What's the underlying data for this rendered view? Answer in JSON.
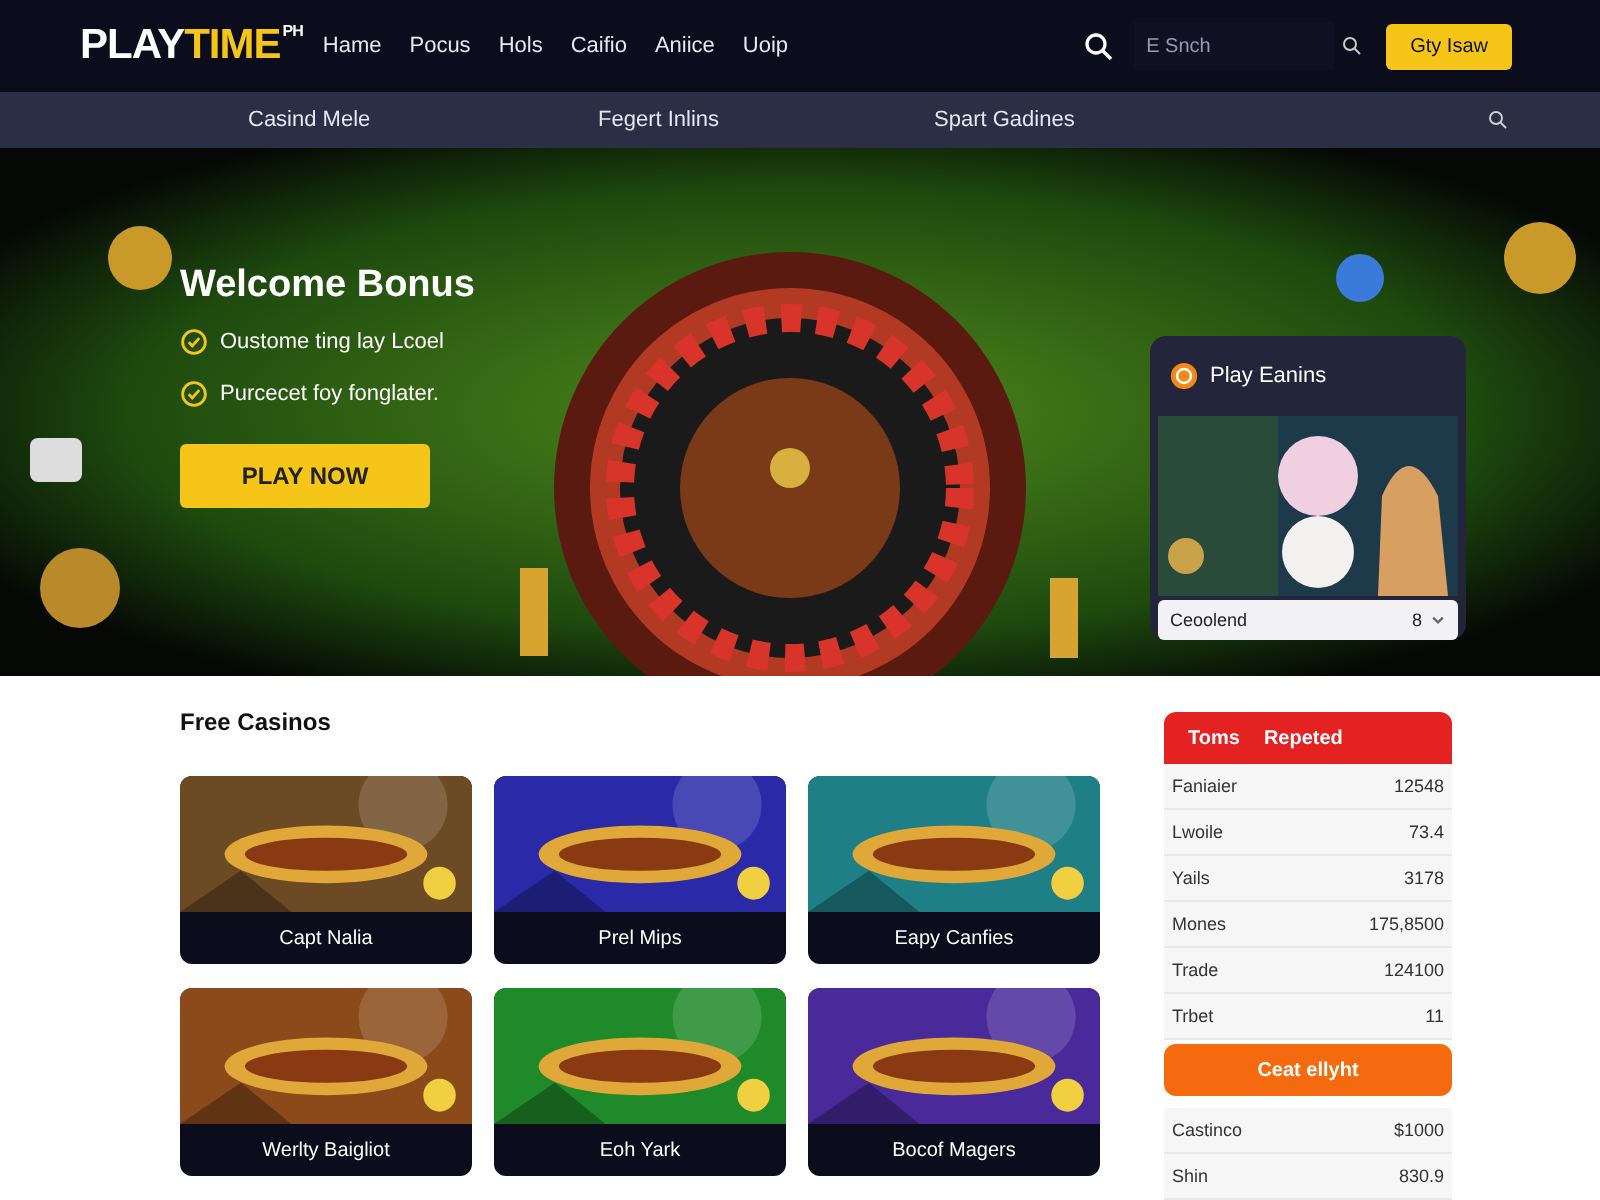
{
  "header": {
    "logo": {
      "main": "PLAY",
      "accent": "TIME",
      "sup": "PH"
    },
    "nav": [
      "Hame",
      "Pocus",
      "Hols",
      "Caifio",
      "Aniice",
      "Uoip"
    ],
    "search": {
      "placeholder": "E Snch"
    },
    "cta": "Gty Isaw"
  },
  "subnav": [
    "Casind Mele",
    "Fegert Inlins",
    "Spart Gadines"
  ],
  "hero": {
    "title": "Welcome Bonus",
    "points": [
      "Oustome ting lay Lcoel",
      "Purcecet foy fonglater."
    ],
    "button": "PLAY NOW",
    "card": {
      "title": "Play Eanins",
      "select": {
        "value": "Ceoolend",
        "count": "8"
      }
    }
  },
  "free_casinos": {
    "title": "Free Casinos",
    "games": [
      {
        "label": "Capt Nalia",
        "color": "#6b4a24"
      },
      {
        "label": "Prel Mips",
        "color": "#2a2aa8"
      },
      {
        "label": "Eapy Canfies",
        "color": "#1f7f86"
      },
      {
        "label": "Werlty Baigliot",
        "color": "#8a4a1a"
      },
      {
        "label": "Eoh Yark",
        "color": "#1f8a2a"
      },
      {
        "label": "Bocof Magers",
        "color": "#4a2a9a"
      }
    ]
  },
  "stats": {
    "tabs": [
      "Toms",
      "Repeted"
    ],
    "rows": [
      {
        "label": "Faniaier",
        "value": "12548"
      },
      {
        "label": "Lwoile",
        "value": "73.4"
      },
      {
        "label": "Yails",
        "value": "3178"
      },
      {
        "label": "Mones",
        "value": "175,8500"
      },
      {
        "label": "Trade",
        "value": "124100"
      },
      {
        "label": "Trbet",
        "value": "11"
      }
    ],
    "button": "Ceat ellyht",
    "extra_rows": [
      {
        "label": "Castinco",
        "value": "$1000"
      },
      {
        "label": "Shin",
        "value": "830.9"
      }
    ]
  }
}
